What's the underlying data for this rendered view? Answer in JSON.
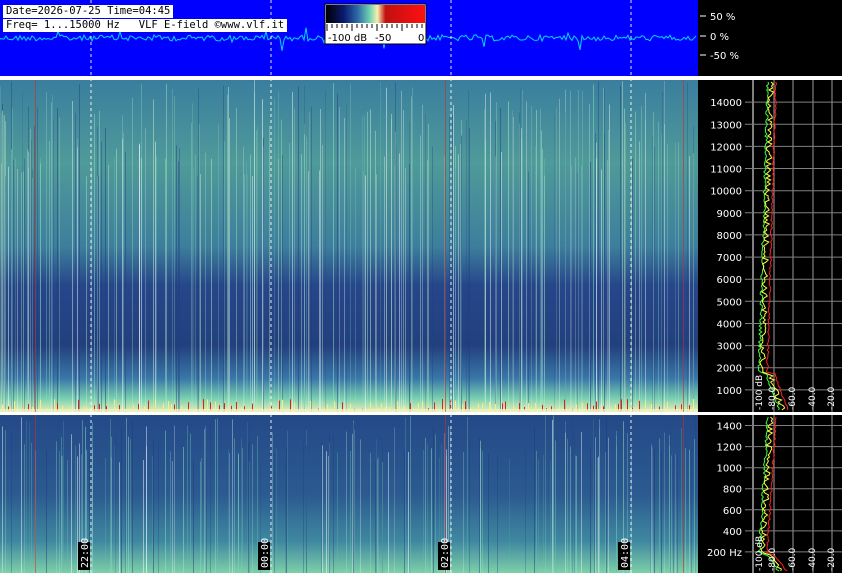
{
  "header": {
    "date_line": "Date=2026-07-25 Time=04:45",
    "freq_line": "Freq= 1...15000 Hz   VLF E-field ©www.vlf.it"
  },
  "colorbar": {
    "ticks": [
      "-100 dB",
      "-50",
      "0"
    ],
    "colors": [
      "#000000",
      "#0a1a6e",
      "#2e6aa8",
      "#6fd0b0",
      "#f5f0b0",
      "#c01010",
      "#ff1010"
    ]
  },
  "waveform": {
    "percent_labels": [
      "50 %",
      "0 %",
      "-50 %"
    ],
    "background": "#0000ff",
    "trace_color": "#00d8ff"
  },
  "upper_spectrogram": {
    "freq_ticks": [
      {
        "hz": 1000,
        "label": "1000"
      },
      {
        "hz": 2000,
        "label": "2000"
      },
      {
        "hz": 3000,
        "label": "3000"
      },
      {
        "hz": 4000,
        "label": "4000"
      },
      {
        "hz": 5000,
        "label": "5000"
      },
      {
        "hz": 6000,
        "label": "6000"
      },
      {
        "hz": 7000,
        "label": "7000"
      },
      {
        "hz": 8000,
        "label": "8000"
      },
      {
        "hz": 9000,
        "label": "9000"
      },
      {
        "hz": 10000,
        "label": "10000"
      },
      {
        "hz": 11000,
        "label": "11000"
      },
      {
        "hz": 12000,
        "label": "12000"
      },
      {
        "hz": 13000,
        "label": "13000"
      },
      {
        "hz": 14000,
        "label": "14000"
      }
    ],
    "max_hz": 15000,
    "db_labels": [
      "-100 dB",
      "-80.0",
      "-60.0",
      "-40.0",
      "-20.0"
    ]
  },
  "lower_spectrogram": {
    "freq_ticks": [
      {
        "hz": 200,
        "label": "200 Hz"
      },
      {
        "hz": 400,
        "label": "400"
      },
      {
        "hz": 600,
        "label": "600"
      },
      {
        "hz": 800,
        "label": "800"
      },
      {
        "hz": 1000,
        "label": "1000"
      },
      {
        "hz": 1200,
        "label": "1200"
      },
      {
        "hz": 1400,
        "label": "1400"
      }
    ],
    "max_hz": 1500,
    "db_labels": [
      "-100 dB",
      "-80.0",
      "-60.0",
      "-40.0",
      "-20.0"
    ]
  },
  "time_markers": [
    "22:00",
    "00:00",
    "02:00",
    "04:00"
  ],
  "spectrum_colors": {
    "average": "#ff2020",
    "current": "#ffff40",
    "minimum": "#40ff40"
  }
}
